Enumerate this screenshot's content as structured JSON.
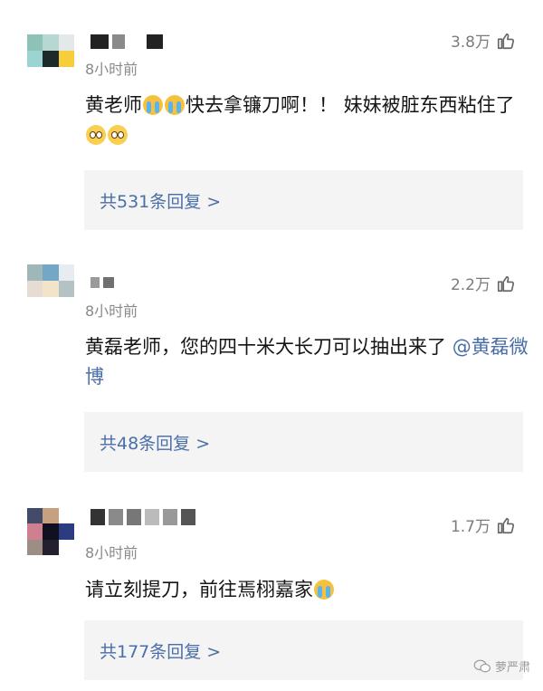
{
  "comments": [
    {
      "time": "8小时前",
      "likes": "3.8万",
      "text_parts": [
        "黄老师",
        "快去拿镰刀啊！！ 妹妹被脏东西粘住了"
      ],
      "emojis": [
        "crying-face",
        "crying-face",
        "pleading-face",
        "pleading-face"
      ],
      "replies": "共531条回复 >",
      "avatar_colors": [
        "#8fc2b6",
        "#b7d8d2",
        "#e4e8e8",
        "#9cd4d4",
        "#1d2a2a",
        "#f7cd3b"
      ],
      "name_blocks": [
        "#222222",
        "#8a8a8a",
        "#ffffff",
        "#222222"
      ]
    },
    {
      "time": "8小时前",
      "likes": "2.2万",
      "text_main": "黄磊老师，您的四十米大长刀可以抽出来了",
      "mention": "@黄磊微博",
      "replies": "共48条回复 >",
      "avatar_colors": [
        "#9fb7b7",
        "#74a6c6",
        "#e6ecef",
        "#e7dcd2",
        "#f2e4c9",
        "#b4c2c5"
      ],
      "name_blocks": [
        "#9a9a9a",
        "#707070"
      ]
    },
    {
      "time": "8小时前",
      "likes": "1.7万",
      "text_main": "请立刻提刀，前往焉栩嘉家",
      "emojis": [
        "crying-face"
      ],
      "replies": "共177条回复 >",
      "avatar_colors": [
        "#434a6a",
        "#c7a07f",
        "#ffffff",
        "#cf8090",
        "#101020",
        "#2b3c80",
        "#9c8d85",
        "#242030",
        "#ffffff"
      ],
      "name_blocks": [
        "#333333",
        "#8a8a8a",
        "#777777",
        "#bbbbbb",
        "#999999",
        "#555555"
      ]
    }
  ],
  "watermark": "萝严肃"
}
